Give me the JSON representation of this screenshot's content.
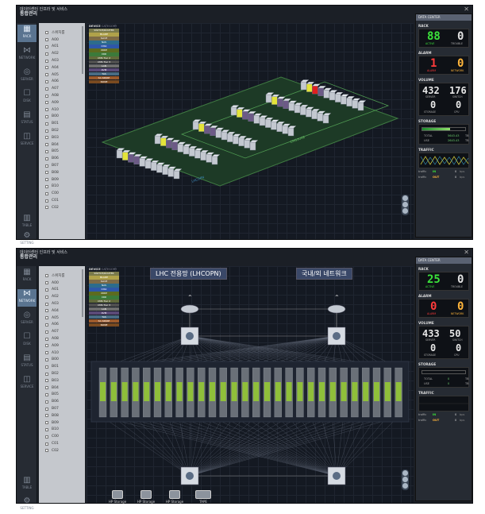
{
  "app": {
    "title_line1": "데이터센터 인프라 및 서비스",
    "title_line2": "통합관리",
    "close": "✕"
  },
  "iconbar": [
    {
      "label": "RACK",
      "icon": "rack-icon"
    },
    {
      "label": "NETWORK",
      "icon": "network-icon"
    },
    {
      "label": "SERVER",
      "icon": "server-icon"
    },
    {
      "label": "DISK",
      "icon": "disk-icon"
    },
    {
      "label": "STATUS",
      "icon": "status-icon"
    },
    {
      "label": "SERVICE",
      "icon": "service-icon"
    }
  ],
  "iconbar_bottom": [
    {
      "label": "TABLE",
      "icon": "table-icon"
    },
    {
      "label": "SETTING",
      "icon": "setting-icon"
    }
  ],
  "rack_list": [
    "스위치룸",
    "A00",
    "A01",
    "A02",
    "A03",
    "A04",
    "A05",
    "A06",
    "A07",
    "A08",
    "A09",
    "A10",
    "B00",
    "B01",
    "B02",
    "B03",
    "B04",
    "B05",
    "B06",
    "B07",
    "B08",
    "B09",
    "B10",
    "C00",
    "C01",
    "C02"
  ],
  "legend": {
    "title": "DEVICE",
    "subtitle": "CATEGORY",
    "items": [
      {
        "label": "SWITCH/ROUTER",
        "color": "#7a7a4a"
      },
      {
        "label": "BLADE",
        "color": "#b0a24a"
      },
      {
        "label": "SLICE",
        "color": "#7d6b46"
      },
      {
        "label": "NAS",
        "color": "#2d6c8c"
      },
      {
        "label": "DISK",
        "color": "#2e57a8"
      },
      {
        "label": "XRDP",
        "color": "#5c6b20"
      },
      {
        "label": "XRD",
        "color": "#3c7a3a"
      },
      {
        "label": "CMS Tier 2",
        "color": "#606a3a"
      },
      {
        "label": "CMS Tier 3",
        "color": "#4f4f4f"
      },
      {
        "label": "LAN",
        "color": "#6e6e6e"
      },
      {
        "label": "KVM",
        "color": "#5b4a78"
      },
      {
        "label": "TAS",
        "color": "#4a6c84"
      },
      {
        "label": "SC-SPARE",
        "color": "#9c5a2c"
      },
      {
        "label": "NONE",
        "color": "#7a4a20"
      }
    ]
  },
  "view1": {
    "zone_label_1": "LHCOPN",
    "zone_label_2": "CMS3U08",
    "right": {
      "panel_header": "DATA CENTER",
      "rack": {
        "title": "RACK",
        "active": "88",
        "trouble": "0",
        "active_label": "ACTIVE",
        "trouble_label": "TROUBLE"
      },
      "alarm": {
        "title": "ALARM",
        "alarm": "1",
        "network": "0",
        "alarm_label": "ALARM",
        "network_label": "NETWORK"
      },
      "volume": {
        "title": "VOLUME",
        "server": "432",
        "switch": "176",
        "storage": "0",
        "cpu": "0",
        "server_label": "SERVER",
        "switch_label": "SWITCH",
        "storage_label": "STORAGE",
        "cpu_label": "CPU"
      },
      "storage": {
        "title": "STORAGE",
        "total_label": "TOTAL",
        "total": "5643.43",
        "total_unit": "TB",
        "use_label": "USE",
        "use": "2643.43",
        "use_unit": "TB",
        "fill": 0.65
      },
      "traffic": {
        "title": "TRAFFIC",
        "in_label": "traffic",
        "in_dir": "IN",
        "in_val": "0",
        "in_unit": "bps",
        "out_label": "traffic",
        "out_dir": "OUT",
        "out_val": "0",
        "out_unit": "bps"
      }
    }
  },
  "view2": {
    "label_left": "LHC 전용망 (LHCOPN)",
    "label_right": "국내/외 네트워크",
    "storage_items": [
      "HP Storage",
      "HP Storage",
      "HP Storage",
      "TAPE"
    ],
    "right": {
      "panel_header": "DATA CENTER",
      "rack": {
        "title": "RACK",
        "active": "25",
        "trouble": "0",
        "active_label": "ACTIVE",
        "trouble_label": "TROUBLE"
      },
      "alarm": {
        "title": "ALARM",
        "alarm": "0",
        "network": "0",
        "alarm_label": "ALARM",
        "network_label": "NETWORK"
      },
      "volume": {
        "title": "VOLUME",
        "server": "433",
        "switch": "50",
        "storage": "0",
        "cpu": "0",
        "server_label": "SERVER",
        "switch_label": "SWITCH",
        "storage_label": "STORAGE",
        "cpu_label": "CPU"
      },
      "storage": {
        "title": "STORAGE",
        "total_label": "TOTAL",
        "total": "0",
        "total_unit": "TB",
        "use_label": "USE",
        "use": "0",
        "use_unit": "TB",
        "fill": 0.0
      },
      "traffic": {
        "title": "TRAFFIC",
        "in_label": "traffic",
        "in_dir": "IN",
        "in_val": "0",
        "in_unit": "bps",
        "out_label": "traffic",
        "out_dir": "OUT",
        "out_val": "0",
        "out_unit": "bps"
      }
    }
  }
}
